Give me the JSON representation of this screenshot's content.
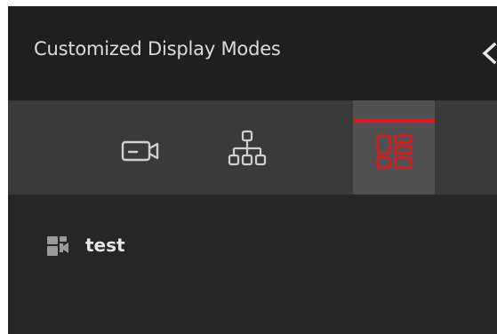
{
  "panel": {
    "title": "Customized Display Modes",
    "collapse_icon": "chevron-left-icon"
  },
  "tabs": [
    {
      "id": "camera",
      "icon": "camera-icon",
      "active": false
    },
    {
      "id": "organization",
      "icon": "org-tree-icon",
      "active": false
    },
    {
      "id": "customized",
      "icon": "layout-grid-icon",
      "active": true
    }
  ],
  "list": {
    "items": [
      {
        "label": "test",
        "icon": "display-mode-icon"
      }
    ]
  },
  "colors": {
    "background": "#262626",
    "header": "#1f1f1f",
    "tabbar": "#3a3a3a",
    "active_tab": "#505050",
    "accent": "#e0161b",
    "icon": "#d0d0d0"
  }
}
